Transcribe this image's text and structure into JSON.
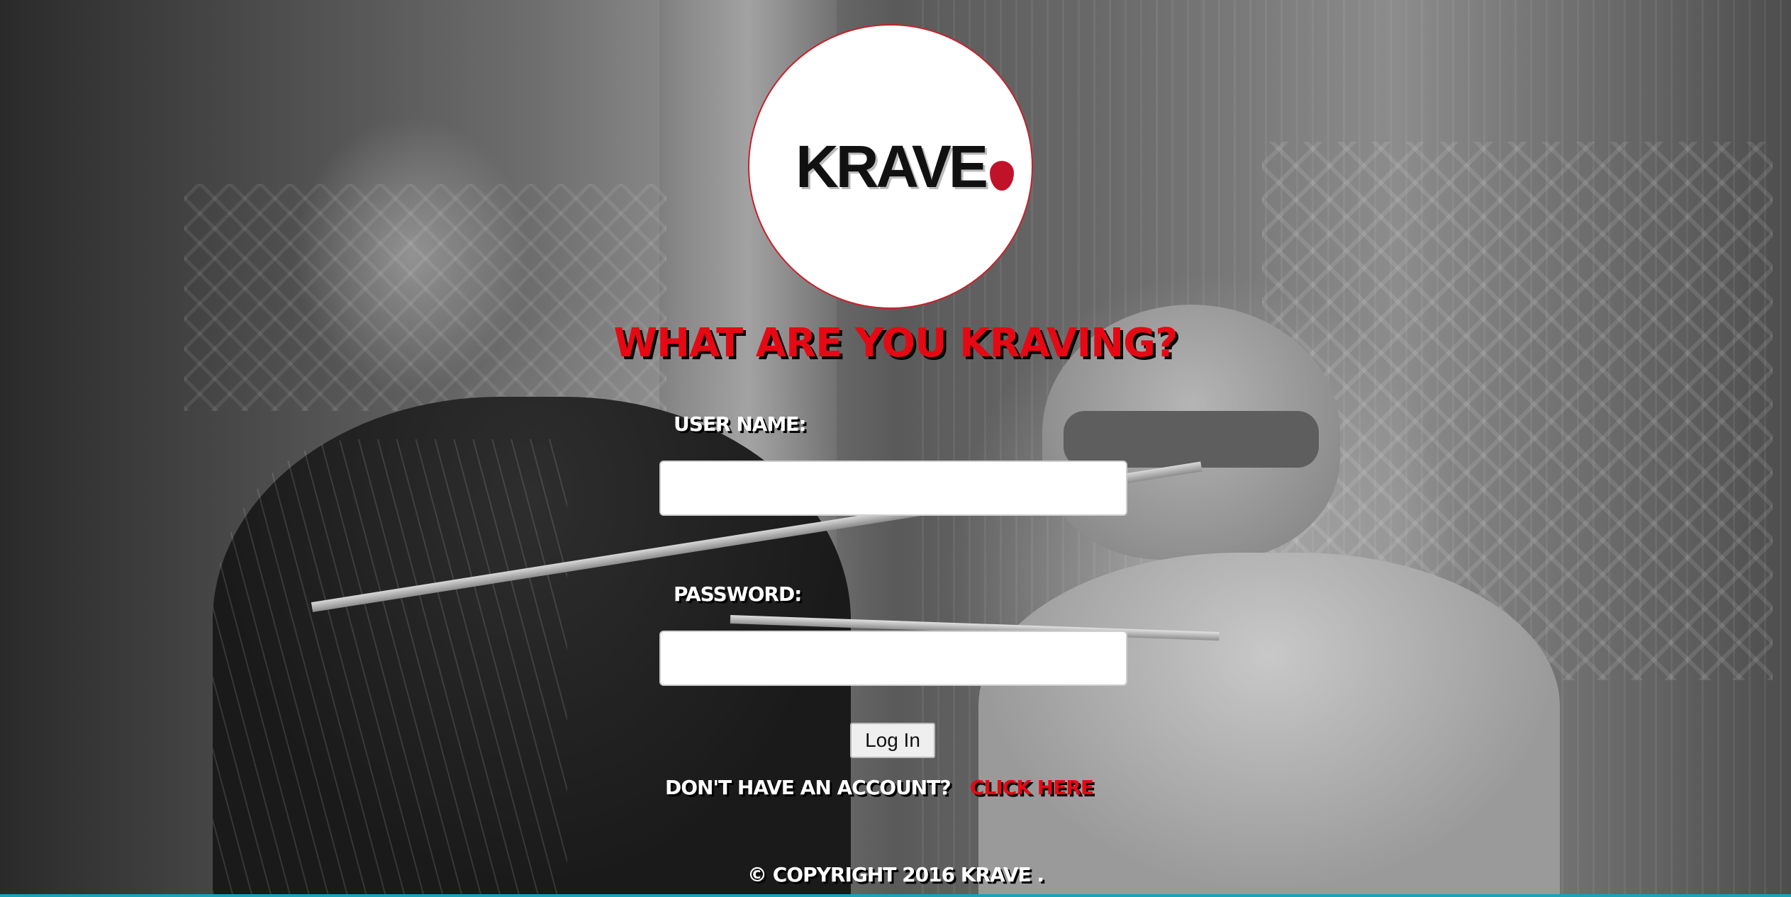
{
  "logo": {
    "text": "KRAVE",
    "icon": "strawberry-icon"
  },
  "heading": "WHAT ARE YOU KRAVING?",
  "form": {
    "username_label": "USER NAME:",
    "username_value": "",
    "password_label": "PASSWORD:",
    "password_value": "",
    "login_label": "Log In"
  },
  "signup": {
    "prompt": "DON'T HAVE AN ACCOUNT?",
    "link_label": "CLICK HERE"
  },
  "footer": {
    "copyright": "© COPYRIGHT 2016 KRAVE ."
  },
  "colors": {
    "accent": "#e50914",
    "text": "#ffffff",
    "footer_line": "#18a3b8"
  }
}
